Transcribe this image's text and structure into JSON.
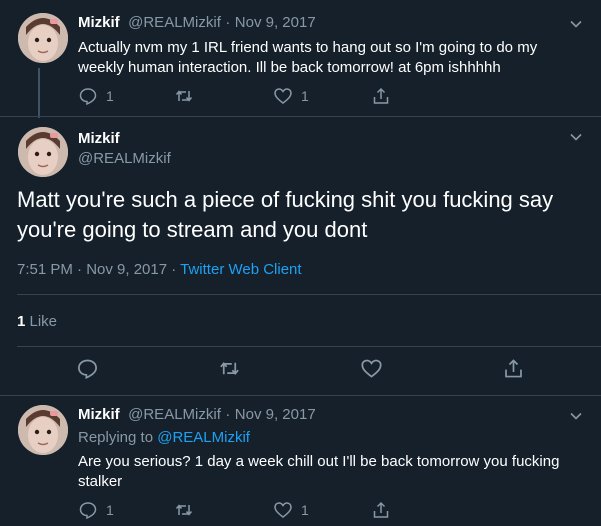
{
  "tweet1": {
    "name": "Mizkif",
    "handle": "@REALMizkif",
    "dot": "·",
    "date": "Nov 9, 2017",
    "text_line1": "Actually nvm my 1 IRL friend wants to hang out so I'm going to do my",
    "text_line2": "weekly human interaction. Ill be back tomorrow! at 6pm ishhhhh",
    "reply_count": "1",
    "like_count": "1"
  },
  "tweet2": {
    "name": "Mizkif",
    "handle": "@REALMizkif",
    "text_line1": "Matt you're such a piece of fucking shit you fucking say",
    "text_line2": "you're going to stream and you dont",
    "time_date": "7:51 PM · Nov 9, 2017 · ",
    "client": "Twitter Web Client",
    "like_count": "1",
    "like_label": " Like"
  },
  "tweet3": {
    "name": "Mizkif",
    "handle": "@REALMizkif",
    "dot": "·",
    "date": "Nov 9, 2017",
    "replying_to": "Replying to ",
    "reply_handle": "@REALMizkif",
    "text_line1": "Are you serious? 1 day a week chill out I'll be back tomorrow you fucking",
    "text_line2": "stalker",
    "reply_count": "1",
    "like_count": "1"
  },
  "icons": [
    "avatar",
    "chevron-down-icon",
    "reply-icon",
    "retweet-icon",
    "like-icon",
    "share-icon"
  ],
  "colors": {
    "background": "#15202b",
    "secondary_text": "#8899a6",
    "link": "#1da1f2",
    "divider": "#38444d"
  }
}
